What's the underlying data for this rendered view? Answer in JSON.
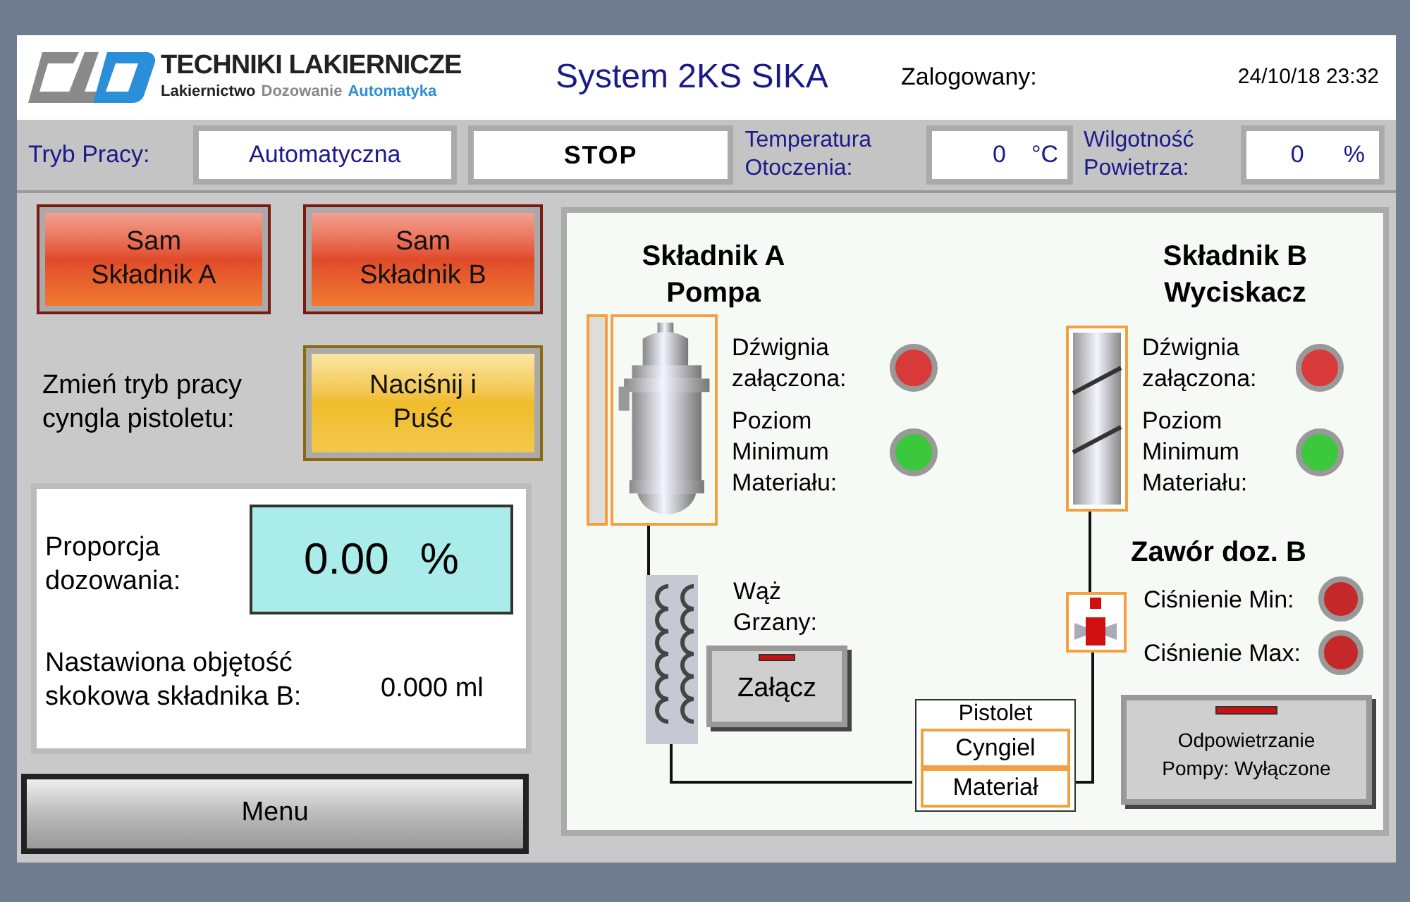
{
  "header": {
    "logo": {
      "name": "TECHNIKI LAKIERNICZE",
      "tagline": [
        "Lakiernictwo",
        "Dozowanie",
        "Automatyka"
      ]
    },
    "title": "System 2KS SIKA",
    "user_label": "Zalogowany:",
    "datetime": "24/10/18 23:32"
  },
  "status_row": {
    "mode": {
      "label": "Tryb Pracy:",
      "value": "Automatyczna"
    },
    "state": "STOP",
    "temperature": {
      "label": "Temperatura\nOtoczenia:",
      "value": "0",
      "unit": "°C"
    },
    "humidity": {
      "label": "Wilgotność\nPowietrza:",
      "value": "0",
      "unit": "%"
    }
  },
  "left_panel": {
    "component_buttons": [
      "Sam\nSkładnik A",
      "Sam\nSkładnik B"
    ],
    "trigger_mode": {
      "label": "Zmień tryb pracy\ncyngla pistoletu:",
      "button": "Naciśnij i\nPuść"
    },
    "ratio": {
      "label": "Proporcja\ndozowania:",
      "value": "0.00",
      "unit": "%"
    },
    "volume": {
      "label": "Nastawiona objętość\nskokowa składnika B:",
      "value": "0.000",
      "unit": "ml"
    },
    "menu_button": "Menu"
  },
  "diagram": {
    "component_a": {
      "title": "Składnik A\nPompa",
      "indicators": [
        {
          "label": "Dźwignia\nzałączona:",
          "color": "#d83a3a"
        },
        {
          "label": "Poziom\nMinimum\nMateriału:",
          "color": "#3cc83c"
        }
      ]
    },
    "component_b": {
      "title": "Składnik B\nWyciskacz",
      "indicators": [
        {
          "label": "Dźwignia\nzałączona:",
          "color": "#d83a3a"
        },
        {
          "label": "Poziom\nMinimum\nMateriału:",
          "color": "#3cc83c"
        }
      ]
    },
    "hose": {
      "label": "Wąż\nGrzany:",
      "button": "Załącz"
    },
    "valve": {
      "title": "Zawór doz. B",
      "indicators": [
        {
          "label": "Ciśnienie Min:",
          "color": "#c42828"
        },
        {
          "label": "Ciśnienie Max:",
          "color": "#c42828"
        }
      ]
    },
    "gun": {
      "title": "Pistolet",
      "items": [
        "Cyngiel",
        "Materiał"
      ]
    },
    "purge_button": "Odpowietrzanie\nPompy: Wyłączone"
  }
}
